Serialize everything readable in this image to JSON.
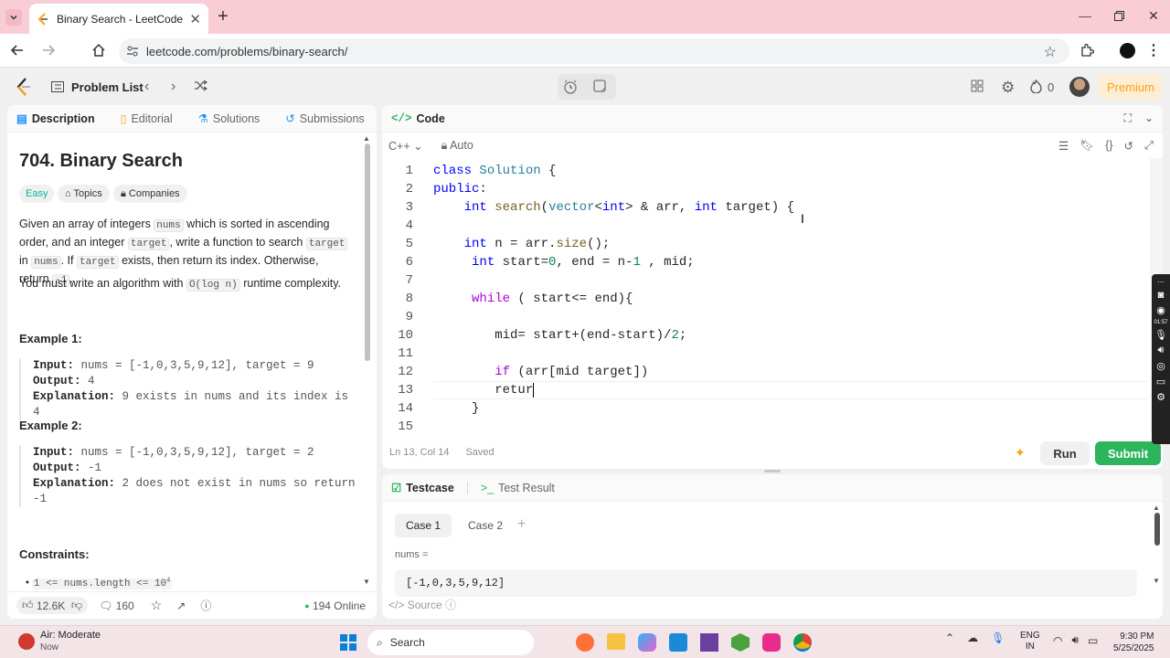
{
  "browser": {
    "tab_title": "Binary Search - LeetCode",
    "url": "leetcode.com/problems/binary-search/"
  },
  "nav": {
    "problem_list": "Problem List",
    "streak": "0",
    "premium": "Premium"
  },
  "left": {
    "tabs": [
      "Description",
      "Editorial",
      "Solutions",
      "Submissions"
    ],
    "title": "704. Binary Search",
    "difficulty": "Easy",
    "topics": "Topics",
    "companies": "Companies",
    "desc": {
      "p1a": "Given an array of integers ",
      "nums": "nums",
      "p1b": " which is sorted in ascending order, and an integer ",
      "target": "target",
      "p1c": ", write a function to search ",
      "p1d": " in ",
      "p1e": ". If ",
      "p1f": " exists, then return its index. Otherwise, return ",
      "neg1": "-1",
      "p1g": ".",
      "p2a": "You must write an algorithm with ",
      "ologn": "O(log n)",
      "p2b": " runtime complexity."
    },
    "ex1": {
      "title": "Example 1:",
      "input_l": "Input:",
      "input": " nums = [-1,0,3,5,9,12], target = 9",
      "output_l": "Output:",
      "output": " 4",
      "expl_l": "Explanation:",
      "expl": " 9 exists in nums and its index is 4"
    },
    "ex2": {
      "title": "Example 2:",
      "input_l": "Input:",
      "input": " nums = [-1,0,3,5,9,12], target = 2",
      "output_l": "Output:",
      "output": " -1",
      "expl_l": "Explanation:",
      "expl": " 2 does not exist in nums so return",
      "expl2": "-1"
    },
    "constraints": "Constraints:",
    "constraint1a": "1 <= nums.length <= 10",
    "constraint1b": "4",
    "likes": "12.6K",
    "comments": "160",
    "online": "194 Online"
  },
  "code": {
    "header": "Code",
    "lang": "C++",
    "auto": "Auto",
    "status_pos": "Ln 13, Col 14",
    "status_saved": "Saved",
    "run": "Run",
    "submit": "Submit",
    "lines": [
      {
        "n": "1",
        "html": "<span class='kw'>class</span> <span class='ty'>Solution</span> {"
      },
      {
        "n": "2",
        "html": "<span class='kw'>public</span>:"
      },
      {
        "n": "3",
        "html": "    <span class='kw'>int</span> <span class='fn'>search</span>(<span class='ty'>vector</span>&lt;<span class='kw'>int</span>&gt; &amp; arr, <span class='kw'>int</span> target) {"
      },
      {
        "n": "4",
        "html": ""
      },
      {
        "n": "5",
        "html": "    <span class='kw'>int</span> n = arr.<span class='fn'>size</span>();"
      },
      {
        "n": "6",
        "html": "     <span class='kw'>int</span> start=<span class='nm'>0</span>, end = n-<span class='nm'>1</span> , mid;"
      },
      {
        "n": "7",
        "html": ""
      },
      {
        "n": "8",
        "html": "     <span class='kw2'>while</span> ( start&lt;= end){"
      },
      {
        "n": "9",
        "html": ""
      },
      {
        "n": "10",
        "html": "        mid= start+(end-start)/<span class='nm'>2</span>;"
      },
      {
        "n": "11",
        "html": ""
      },
      {
        "n": "12",
        "html": "        <span class='kw2'>if</span> (arr[mid target])"
      },
      {
        "n": "13",
        "html": "        retur<span style='border-right:1.5px solid #000'>&#8203;</span>"
      },
      {
        "n": "14",
        "html": "     }"
      },
      {
        "n": "15",
        "html": ""
      }
    ]
  },
  "testcase": {
    "tab1": "Testcase",
    "tab2": "Test Result",
    "case1": "Case 1",
    "case2": "Case 2",
    "var": "nums =",
    "value": "[-1,0,3,5,9,12]",
    "source": "Source"
  },
  "taskbar": {
    "weather": "Air: Moderate",
    "weather_sub": "Now",
    "search": "Search",
    "lang1": "ENG",
    "lang2": "IN",
    "time": "9:30 PM",
    "date": "5/25/2025"
  },
  "sidebar_time": "01:57",
  "colors": {
    "accent": "#2db55d",
    "easy": "#00b8a3",
    "premium": "#ffa116"
  }
}
